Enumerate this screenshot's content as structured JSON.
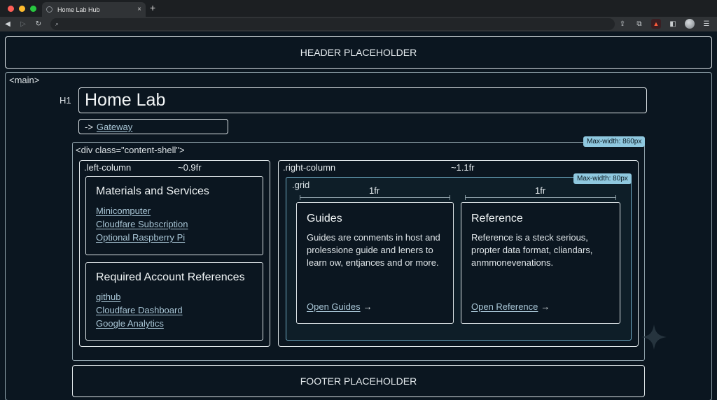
{
  "browser": {
    "tab_title": "Home Lab Hub",
    "tab_close": "×",
    "new_tab": "+",
    "address_value": "",
    "icons": [
      "back-icon",
      "forward-icon",
      "reload-icon",
      "search-icon",
      "share-icon",
      "extensions-icon",
      "brave-icon",
      "sidebar-icon",
      "profile-avatar",
      "menu-icon"
    ]
  },
  "header": {
    "placeholder": "HEADER PLACEHOLDER"
  },
  "main": {
    "tag_label": "<main>",
    "h1_label": "H1",
    "title": "Home Lab",
    "gateway": {
      "arrow": "->",
      "label": "Gateway"
    },
    "shell": {
      "label": "<div class=\"content-shell\">",
      "max_width_badge": "Max-width: 860px"
    },
    "left_column": {
      "label": ".left-column",
      "fr": "~0.9fr",
      "cards": [
        {
          "title": "Materials and Services",
          "links": [
            "Minicomputer",
            "Cloudfare Subscription",
            "Optional Raspberry Pi"
          ]
        },
        {
          "title": "Required Account References",
          "links": [
            "github",
            "Cloudfare Dashboard",
            "Google Analytics"
          ]
        }
      ]
    },
    "right_column": {
      "label": ".right-column",
      "fr": "~1.1fr",
      "grid": {
        "label": ".grid",
        "max_width_badge": "Max-width: 80px",
        "fr_labels": [
          "1fr",
          "1fr"
        ],
        "cards": [
          {
            "title": "Guides",
            "description": "Guides arе conments in host and prolessione guide and leners to learn ow, entjances and or more.",
            "link": "Open Guides",
            "arrow": "→"
          },
          {
            "title": "Reference",
            "description": "Reference is a steck serious, propter data format, cliandars, anmmonevenations.",
            "link": "Open Reference",
            "arrow": "→"
          }
        ]
      }
    }
  },
  "footer": {
    "placeholder": "FOOTER PLACEHOLDER"
  },
  "colors": {
    "background": "#0b1620",
    "border": "#dfe6e9",
    "accent_badge": "#8fc8df",
    "link": "#a9c6d6"
  }
}
